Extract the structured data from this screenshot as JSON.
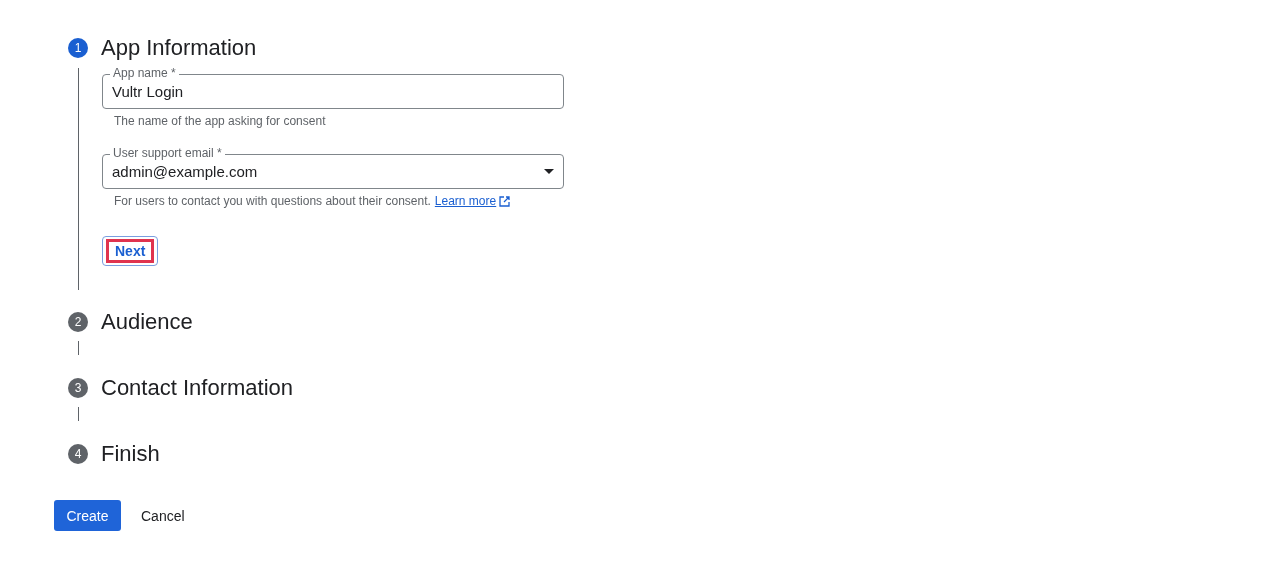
{
  "steps": [
    {
      "number": "1",
      "title": "App Information",
      "active": true,
      "fields": [
        {
          "kind": "text",
          "label": "App name *",
          "value": "Vultr Login",
          "helper": "The name of the app asking for consent"
        },
        {
          "kind": "select",
          "label": "User support email *",
          "value": "admin@example.com",
          "helper": "For users to contact you with questions about their consent.",
          "link": "Learn more"
        }
      ],
      "next_button": {
        "label": "Next",
        "highlighted": true
      }
    },
    {
      "number": "2",
      "title": "Audience",
      "active": false
    },
    {
      "number": "3",
      "title": "Contact Information",
      "active": false
    },
    {
      "number": "4",
      "title": "Finish",
      "active": false
    }
  ],
  "actions": {
    "primary": "Create",
    "secondary": "Cancel"
  }
}
